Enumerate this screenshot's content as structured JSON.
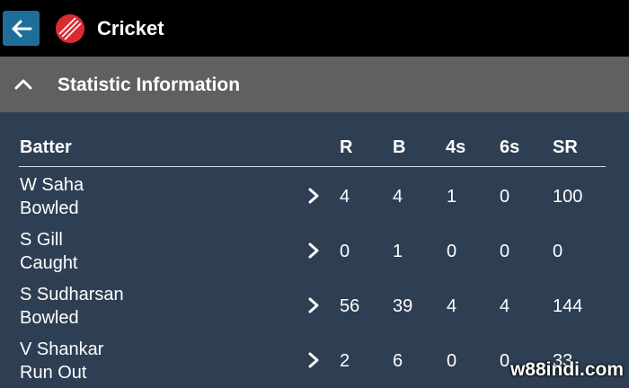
{
  "topbar": {
    "title": "Cricket"
  },
  "section": {
    "title": "Statistic Information"
  },
  "table": {
    "columns": [
      "Batter",
      "R",
      "B",
      "4s",
      "6s",
      "SR"
    ],
    "rows": [
      {
        "name": "W Saha",
        "dismissal": "Bowled",
        "r": "4",
        "b": "4",
        "fours": "1",
        "sixes": "0",
        "sr": "100"
      },
      {
        "name": "S Gill",
        "dismissal": "Caught",
        "r": "0",
        "b": "1",
        "fours": "0",
        "sixes": "0",
        "sr": "0"
      },
      {
        "name": "S Sudharsan",
        "dismissal": "Bowled",
        "r": "56",
        "b": "39",
        "fours": "4",
        "sixes": "4",
        "sr": "144"
      },
      {
        "name": "V Shankar",
        "dismissal": "Run Out",
        "r": "2",
        "b": "6",
        "fours": "0",
        "sixes": "0",
        "sr": "33"
      }
    ]
  },
  "watermark": "w88indi.com",
  "icons": {
    "back": "arrow-left-icon",
    "logo": "cricket-ball-icon",
    "collapse": "chevron-up-icon",
    "row_expand": "chevron-right-icon"
  },
  "colors": {
    "topbar": "#000000",
    "back_button": "#1f6e99",
    "section_header": "#606060",
    "content_bg": "#2e3f53",
    "ball": "#d92b32"
  }
}
